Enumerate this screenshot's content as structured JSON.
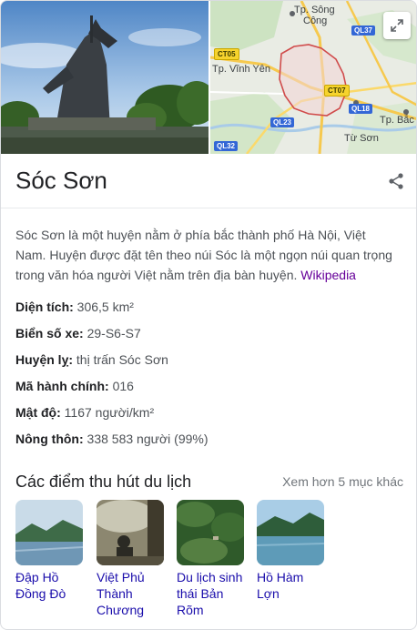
{
  "map": {
    "labels": {
      "song_cong_1": "Tp. Sông",
      "song_cong_2": "Công",
      "vinh_yen": "Tp. Vĩnh Yên",
      "bac_ninh": "Tp. Bắc Nin",
      "tu_son": "Từ Sơn"
    },
    "roads": {
      "ql37": "QL37",
      "ct05": "CT05",
      "ct07": "CT07",
      "ql18": "QL18",
      "ql23": "QL23",
      "ql32": "QL32"
    },
    "expand_icon": "expand-icon"
  },
  "title": "Sóc Sơn",
  "share_icon": "share-icon",
  "description": {
    "text": "Sóc Sơn là một huyện nằm ở phía bắc thành phố Hà Nội, Việt Nam. Huyện được đặt tên theo núi Sóc là một ngọn núi quan trọng trong văn hóa người Việt nằm trên địa bàn huyện.",
    "source": "Wikipedia"
  },
  "facts": [
    {
      "label": "Diện tích:",
      "value": "306,5 km²"
    },
    {
      "label": "Biển số xe:",
      "value": "29-S6-S7"
    },
    {
      "label": "Huyện lỵ:",
      "value": "thị trấn Sóc Sơn"
    },
    {
      "label": "Mã hành chính:",
      "value": "016"
    },
    {
      "label": "Mật độ:",
      "value": "1167 người/km²"
    },
    {
      "label": "Nông thôn:",
      "value": "338 583 người (99%)"
    }
  ],
  "attractions": {
    "title": "Các điểm thu hút du lịch",
    "more": "Xem hơn 5 mục khác",
    "items": [
      {
        "name": "Đập Hồ Đồng Đò"
      },
      {
        "name": "Việt Phủ Thành Chương"
      },
      {
        "name": "Du lịch sinh thái Bản Rõm"
      },
      {
        "name": "Hồ Hàm Lợn"
      }
    ]
  }
}
